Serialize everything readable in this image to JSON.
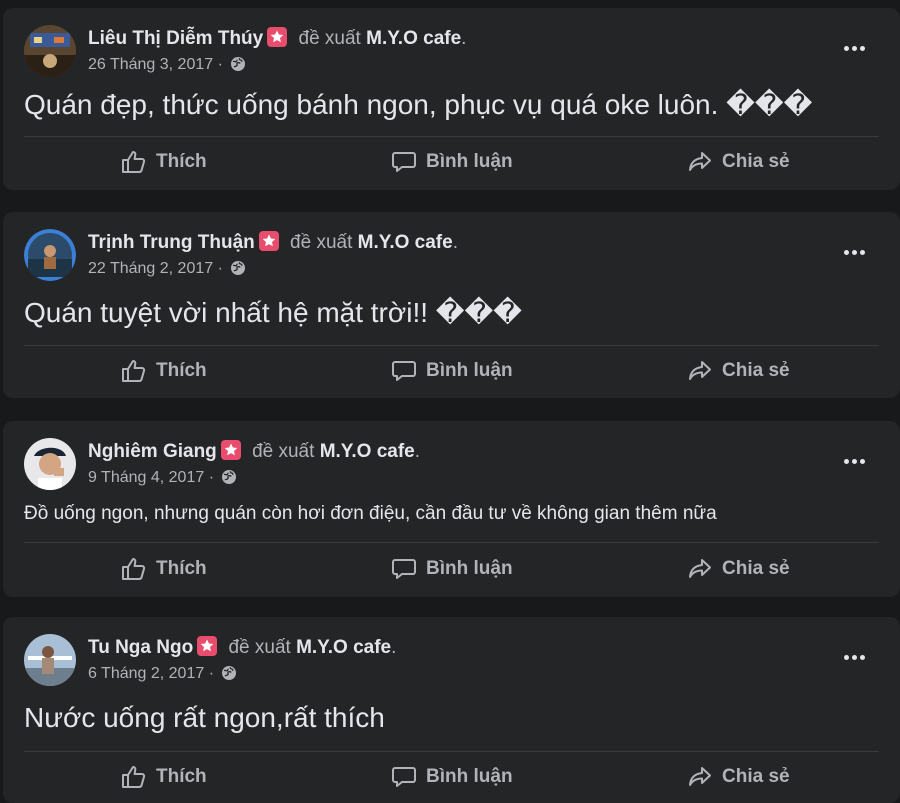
{
  "recommend_text": "đề xuất",
  "page_name": "M.Y.O cafe",
  "period": ".",
  "separator": "·",
  "actions": {
    "like_label": "Thích",
    "comment_label": "Bình luận",
    "share_label": "Chia sẻ"
  },
  "posts": [
    {
      "author": "Liêu Thị Diễm Thúy",
      "date": "26 Tháng 3, 2017",
      "text": "Quán đẹp, thức uống bánh ngon, phục vụ quá oke luôn. ���"
    },
    {
      "author": "Trịnh Trung Thuận",
      "date": "22 Tháng 2, 2017",
      "text": "Quán tuyệt vời nhất hệ mặt trời!! ���"
    },
    {
      "author": "Nghiêm Giang",
      "date": "9 Tháng 4, 2017",
      "text": "Đồ uống ngon, nhưng quán còn hơi đơn điệu, cần đầu tư về không gian thêm nữa"
    },
    {
      "author": "Tu Nga Ngo",
      "date": "6 Tháng 2, 2017",
      "text": "Nước uống rất ngon,rất thích"
    }
  ],
  "colors": {
    "background": "#18191a",
    "card": "#242526",
    "primary_text": "#e4e6eb",
    "secondary_text": "#b0b3b8",
    "recommend_badge": "#e94d6d"
  }
}
